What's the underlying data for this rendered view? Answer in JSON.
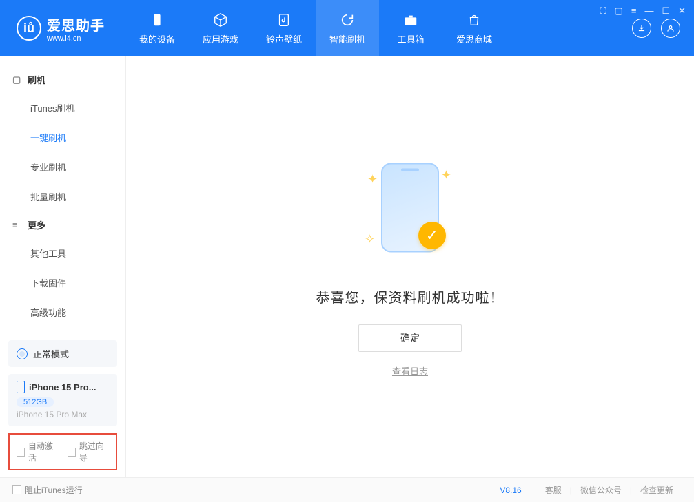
{
  "app": {
    "title": "爱思助手",
    "url": "www.i4.cn"
  },
  "nav": {
    "items": [
      {
        "label": "我的设备"
      },
      {
        "label": "应用游戏"
      },
      {
        "label": "铃声壁纸"
      },
      {
        "label": "智能刷机"
      },
      {
        "label": "工具箱"
      },
      {
        "label": "爱思商城"
      }
    ]
  },
  "sidebar": {
    "section1_title": "刷机",
    "items1": [
      {
        "label": "iTunes刷机"
      },
      {
        "label": "一键刷机"
      },
      {
        "label": "专业刷机"
      },
      {
        "label": "批量刷机"
      }
    ],
    "section2_title": "更多",
    "items2": [
      {
        "label": "其他工具"
      },
      {
        "label": "下载固件"
      },
      {
        "label": "高级功能"
      }
    ],
    "mode_label": "正常模式",
    "device": {
      "name": "iPhone 15 Pro...",
      "storage": "512GB",
      "full": "iPhone 15 Pro Max"
    },
    "opt_auto_activate": "自动激活",
    "opt_skip_wizard": "跳过向导"
  },
  "main": {
    "success_text": "恭喜您，保资料刷机成功啦！",
    "ok_btn": "确定",
    "view_log": "查看日志"
  },
  "footer": {
    "block_itunes": "阻止iTunes运行",
    "version": "V8.16",
    "support": "客服",
    "wechat": "微信公众号",
    "check_update": "检查更新"
  }
}
